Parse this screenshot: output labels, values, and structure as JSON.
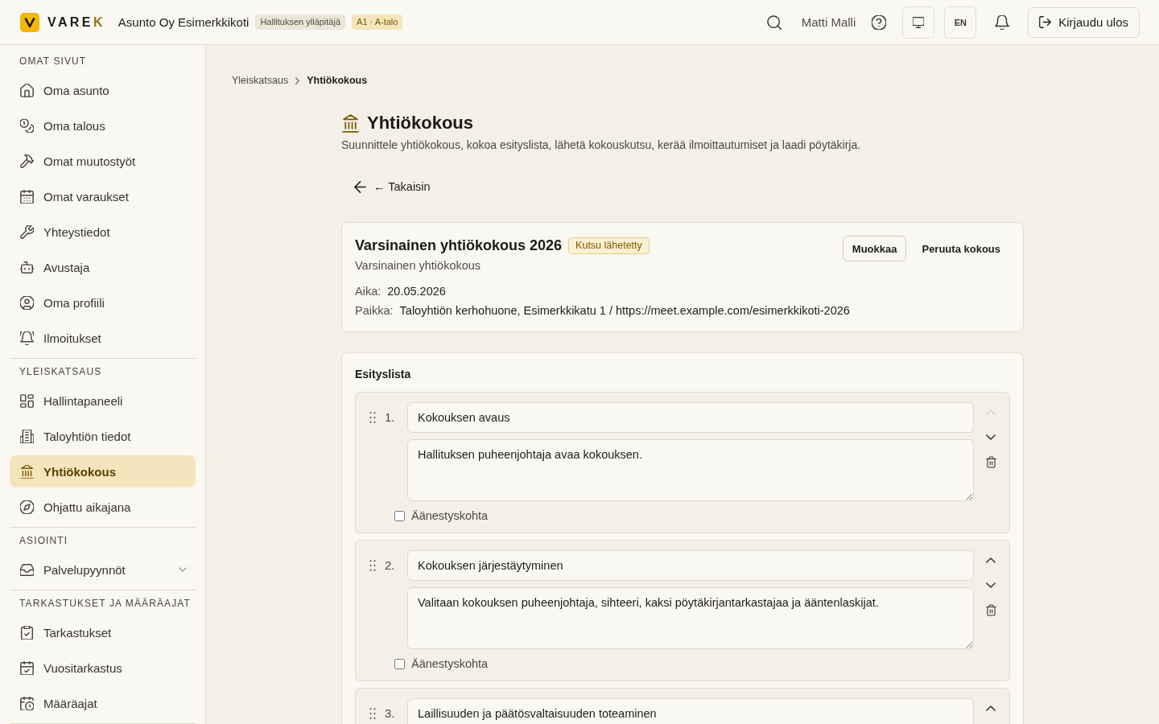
{
  "header": {
    "brand": "VAREK",
    "organization": "Asunto Oy Esimerkkikoti",
    "badges": [
      {
        "text": "Hallituksen ylläpitäjä",
        "kind": "role"
      },
      {
        "text": "A1 · A-talo",
        "kind": "unit"
      }
    ],
    "user_name": "Matti Malli",
    "language": "EN",
    "logout": "Kirjaudu ulos"
  },
  "sidebar": {
    "sections": [
      {
        "heading": "OMAT SIVUT",
        "items": [
          {
            "label": "Oma asunto",
            "selected": false
          },
          {
            "label": "Oma talous",
            "selected": false
          },
          {
            "label": "Omat muutostyöt",
            "selected": false
          },
          {
            "label": "Omat varaukset",
            "selected": false
          },
          {
            "label": "Yhteystiedot",
            "selected": false
          },
          {
            "label": "Avustaja",
            "selected": false
          },
          {
            "label": "Oma profiili",
            "selected": false
          },
          {
            "label": "Ilmoitukset",
            "selected": false
          }
        ]
      },
      {
        "heading": "YLEISKATSAUS",
        "items": [
          {
            "label": "Hallintapaneeli",
            "selected": false
          },
          {
            "label": "Taloyhtiön tiedot",
            "selected": false
          },
          {
            "label": "Yhtiökokous",
            "selected": true
          },
          {
            "label": "Ohjattu aikajana",
            "selected": false
          }
        ]
      },
      {
        "heading": "ASIOINTI",
        "items": [
          {
            "label": "Palvelupyynnöt",
            "selected": false,
            "expanded": false
          }
        ]
      },
      {
        "heading": "TARKASTUKSET JA MÄÄRÄAJAT",
        "items": [
          {
            "label": "Tarkastukset",
            "selected": false
          },
          {
            "label": "Vuositarkastus",
            "selected": false
          },
          {
            "label": "Määräajat",
            "selected": false
          }
        ]
      }
    ]
  },
  "breadcrumb": [
    {
      "label": "Yleiskatsaus",
      "current": false
    },
    {
      "label": "Yhtiökokous",
      "current": true
    }
  ],
  "page": {
    "title": "Yhtiökokous",
    "description": "Suunnittele yhtiökokous, kokoa esityslista, lähetä kokouskutsu, kerää ilmoittautumiset ja laadi pöytäkirja.",
    "back_button": "← Takaisin"
  },
  "meeting": {
    "title": "Varsinainen yhtiökokous 2026",
    "status": "Kutsu lähetetty",
    "type": "Varsinainen yhtiökokous",
    "details": [
      {
        "label": "Aika:",
        "value": "20.05.2026"
      },
      {
        "label": "Paikka:",
        "value": "Taloyhtiön kerhohuone, Esimerkkikatu 1 / https://meet.example.com/esimerkkikoti-2026"
      }
    ],
    "actions": [
      {
        "label": "Muokkaa",
        "kind": "outline"
      },
      {
        "label": "Peruuta kokous",
        "kind": "plain"
      }
    ]
  },
  "agenda": {
    "heading": "Esityslista",
    "items": [
      {
        "number": "1.",
        "title": "Kokouksen avaus",
        "description": "Hallituksen puheenjohtaja avaa kokouksen.",
        "voting": false,
        "voting_label": "Äänestyskohta",
        "up_disabled": true
      },
      {
        "number": "2.",
        "title": "Kokouksen järjestäytyminen",
        "description": "Valitaan kokouksen puheenjohtaja, sihteeri, kaksi pöytäkirjantarkastajaa ja ääntenlaskijat.",
        "voting": false,
        "voting_label": "Äänestyskohta",
        "up_disabled": false
      },
      {
        "number": "3.",
        "title": "Laillisuuden ja päätösvaltaisuuden toteaminen",
        "up_disabled": false
      }
    ]
  }
}
